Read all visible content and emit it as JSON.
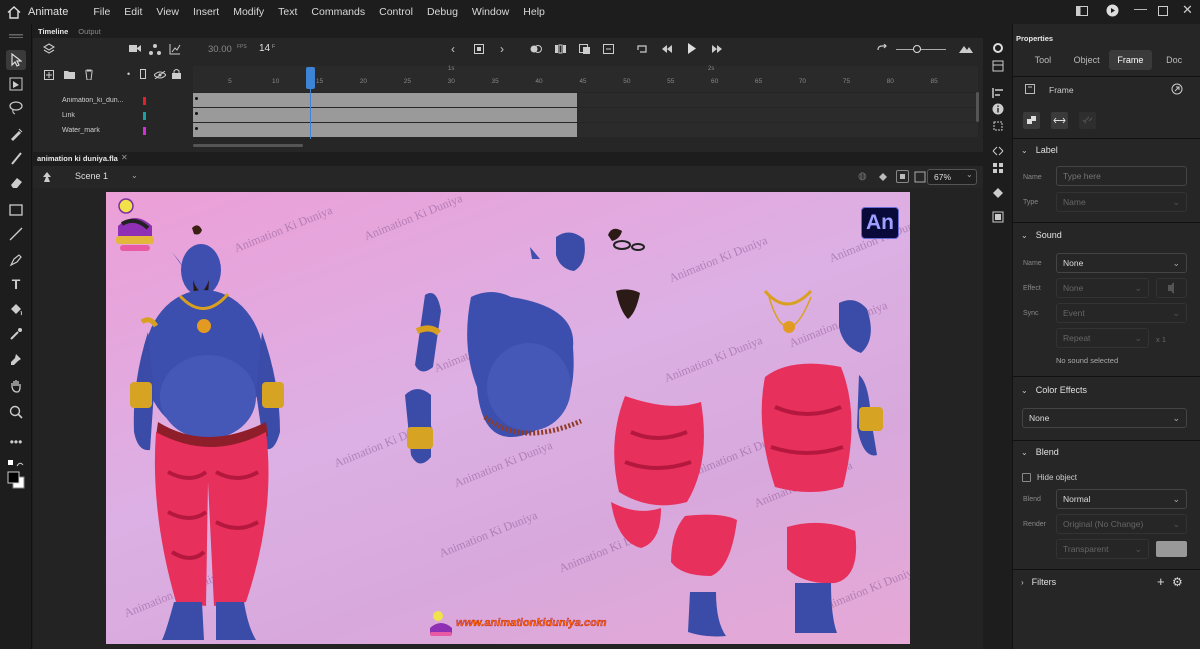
{
  "app": {
    "name": "Animate"
  },
  "menu": [
    "File",
    "Edit",
    "View",
    "Insert",
    "Modify",
    "Text",
    "Commands",
    "Control",
    "Debug",
    "Window",
    "Help"
  ],
  "timeline": {
    "tabs": [
      "Timeline",
      "Output"
    ],
    "fps": "30.00",
    "fps_unit": "FPS",
    "current_frame": "14",
    "frame_unit": "F",
    "ruler_numbers": [
      "5",
      "10",
      "15",
      "20",
      "25",
      "30",
      "35",
      "40",
      "45",
      "50",
      "55",
      "60",
      "65",
      "70",
      "75",
      "80",
      "85"
    ],
    "ruler_seconds": [
      "1s",
      "2s"
    ],
    "layers": [
      {
        "name": "Animation_ki_dun...",
        "color": "#e0202a"
      },
      {
        "name": "Link",
        "color": "#17a2a2"
      },
      {
        "name": "Water_mark",
        "color": "#d62dd6"
      }
    ]
  },
  "document": {
    "tab": "animation ki duniya.fla",
    "scene": "Scene 1",
    "zoom": "67%",
    "stage": {
      "watermark": "Animation Ki Duniya",
      "logo_badge": "An",
      "website": "www.animationkiduniya.com",
      "colors": {
        "skin": "#3d4fa8",
        "pants": "#e8305c",
        "gold": "#d9a020"
      }
    }
  },
  "properties": {
    "title": "Properties",
    "tabs": [
      "Tool",
      "Object",
      "Frame",
      "Doc"
    ],
    "active_tab": "Frame",
    "frame_title": "Frame",
    "label": {
      "header": "Label",
      "name_label": "Name",
      "name_placeholder": "Type here",
      "type_label": "Type",
      "type_value": "Name"
    },
    "sound": {
      "header": "Sound",
      "name_label": "Name",
      "name_value": "None",
      "effect_label": "Effect",
      "effect_value": "None",
      "sync_label": "Sync",
      "sync_value": "Event",
      "repeat_value": "Repeat",
      "repeat_count": "x 1",
      "status": "No sound selected"
    },
    "color_effects": {
      "header": "Color Effects",
      "value": "None"
    },
    "blend": {
      "header": "Blend",
      "hide_object": "Hide object",
      "blend_label": "Blend",
      "blend_value": "Normal",
      "render_label": "Render",
      "render_value": "Original (No Change)",
      "bg_value": "Transparent"
    },
    "filters": {
      "header": "Filters"
    }
  },
  "icons": [
    "home-icon",
    "select-icon",
    "lasso-icon",
    "brush-icon",
    "eraser-icon",
    "rectangle-icon",
    "line-icon",
    "pen-icon",
    "text-icon",
    "bucket-icon",
    "eyedropper-icon",
    "pin-icon",
    "hand-icon",
    "zoom-icon"
  ]
}
